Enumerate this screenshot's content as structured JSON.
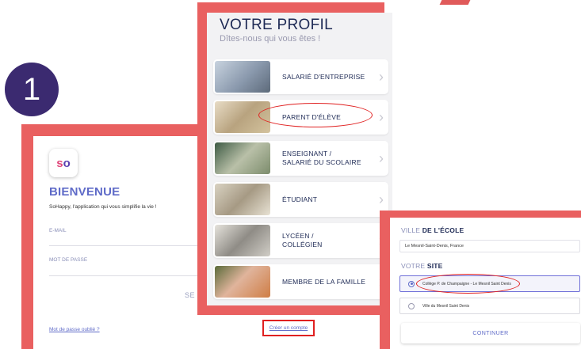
{
  "step_number": "1",
  "login": {
    "logo_text_a": "s",
    "logo_text_b": "o",
    "welcome": "BIENVENUE",
    "subtitle": "SoHappy, l'application qui vous simplifie la vie !",
    "email_label": "E-MAIL",
    "password_label": "MOT DE PASSE",
    "connect_button": "SE CONNECT",
    "forgot_password": "Mot de passe oublié ?",
    "create_account": "Créer un compte"
  },
  "profile": {
    "title": "VOTRE PROFIL",
    "subtitle": "Dîtes-nous qui vous êtes !",
    "items": [
      {
        "label": "SALARIÉ D'ENTREPRISE"
      },
      {
        "label": "PARENT D'ÉLÈVE"
      },
      {
        "label_line1": "ENSEIGNANT /",
        "label_line2": "SALARIÉ DU SCOLAIRE"
      },
      {
        "label": "ÉTUDIANT"
      },
      {
        "label_line1": "LYCÉEN /",
        "label_line2": "COLLÉGIEN"
      },
      {
        "label": "MEMBRE DE LA FAMILLE"
      }
    ],
    "chevron": "›"
  },
  "school": {
    "city_label_prefix": "VILLE",
    "city_label_bold": "DE L'ÉCOLE",
    "city_value": "Le Mesnil-Saint-Denis, France",
    "site_label_prefix": "VOTRE",
    "site_label_bold": "SITE",
    "options": [
      {
        "label": "Collège P. de Champaigne - Le Mesnil Saint Denis",
        "selected": true
      },
      {
        "label": "Ville du Mesnil Saint Denis",
        "selected": false
      }
    ],
    "continue_button": "CONTINUER"
  },
  "colors": {
    "frame": "#e96060",
    "accent": "#5f6bc8",
    "highlight": "#e02020",
    "badge": "#3b2a70"
  }
}
